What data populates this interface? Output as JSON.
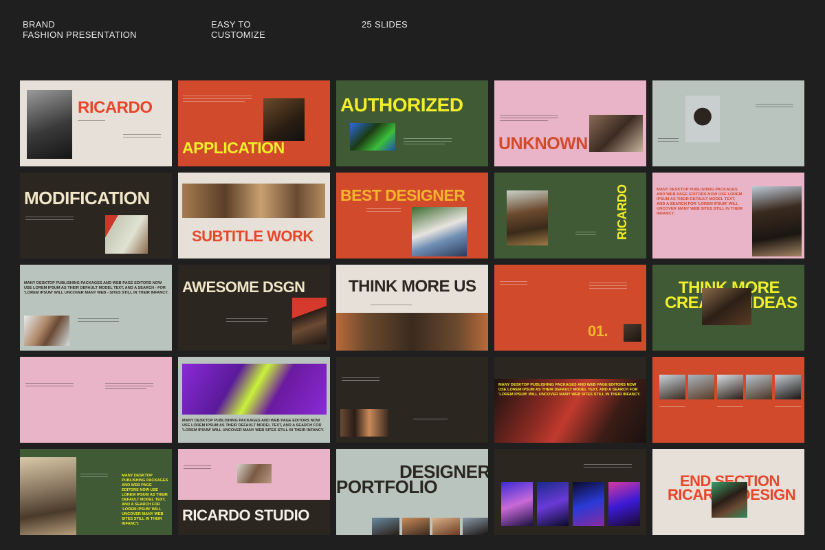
{
  "header": {
    "brand_line1": "BRAND",
    "brand_line2": "FASHION PRESENTATION",
    "easy_line1": "EASY TO",
    "easy_line2": "CUSTOMIZE",
    "slides_count": "25 SLIDES"
  },
  "slides": {
    "s1": {
      "title": "RICARDO"
    },
    "s2": {
      "title": "APPLICATION"
    },
    "s3": {
      "title": "AUTHORIZED"
    },
    "s4": {
      "title": "UNKNOWN"
    },
    "s6": {
      "title": "MODIFICATION"
    },
    "s7": {
      "title": "SUBTITLE WORK"
    },
    "s8": {
      "title": "BEST DESIGNER"
    },
    "s9": {
      "title": "RICARDO"
    },
    "s10": {
      "para": "MANY DESKTOP PUBLISHING PACKAGES AND WEB PAGE EDITORS NOW USE LOREM IPSUM AS THEIR DEFAULT MODEL TEXT, AND A SEARCH FOR 'LOREM IPSUM' WILL UNCOVER MANY WEB SITES STILL IN THEIR INFANCY."
    },
    "s11": {
      "para": "MANY DESKTOP PUBLISHING PACKAGES AND WEB PAGE EDITORS NOW USE LOREM IPSUM AS THEIR DEFAULT MODEL TEXT, AND A SEARCH - FOR 'LOREM IPSUM' WILL UNCOVER MANY WEB - SITES STILL IN THEIR INFANCY."
    },
    "s12": {
      "title": "AWESOME DSGN"
    },
    "s13": {
      "title": "THINK MORE US"
    },
    "s14": {
      "number": "01."
    },
    "s15": {
      "line1": "THINK MORE",
      "line2": "CREATIVE IDEAS"
    },
    "s17": {
      "para": "MANY DESKTOP PUBLISHING PACKAGES AND WEB PAGE EDITORS NOW USE LOREM IPSUM AS THEIR DEFAULT MODEL TEXT, AND A SEARCH FOR 'LOREM IPSUM' WILL UNCOVER MANY WEB SITES STILL IN THEIR INFANCY."
    },
    "s19": {
      "para": "MANY DESKTOP PUBLISHING PACKAGES AND WEB PAGE EDITORS NOW USE LOREM IPSUM AS THEIR DEFAULT MODEL TEXT, AND A SEARCH FOR 'LOREM IPSUM' WILL UNCOVER MANY WEB SITES STILL IN THEIR INFANCY."
    },
    "s21": {
      "para": "MANY DESKTOP PUBLISHING PACKAGES AND WEB PAGE EDITORS NOW USE LOREM IPSUM AS THEIR DEFAULT MODEL TEXT, AND A SEARCH FOR 'LOREM IPSUM' WILL UNCOVER MANY WEB SITES STILL IN THEIR INFANCY."
    },
    "s22": {
      "title": "RICARDO STUDIO"
    },
    "s23": {
      "line1": "DESIGNER",
      "line2": "PORTFOLIO"
    },
    "s25": {
      "line1": "END SECTION",
      "line2": "RICARDO DESIGN"
    }
  },
  "colors": {
    "background": "#1f1f1f",
    "cream": "#e6e0d8",
    "orange_red": "#d24a2c",
    "forest_green": "#3f5a34",
    "pink": "#e9b4c7",
    "sage_gray": "#b9c4be",
    "dark_brown": "#2c2621",
    "yellow": "#f3ee2a",
    "accent_red": "#e8462a"
  }
}
